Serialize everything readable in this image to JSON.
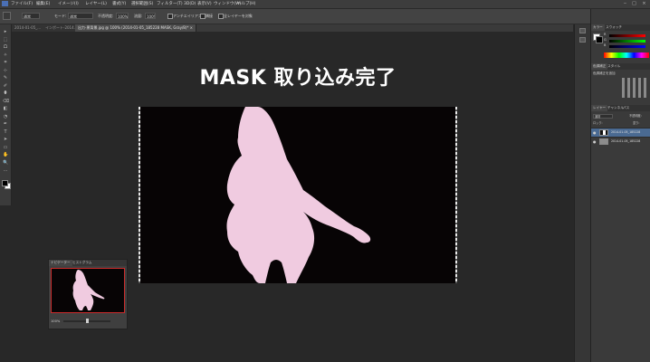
{
  "menu": {
    "items": [
      "ファイル(F)",
      "編集(E)",
      "イメージ(I)",
      "レイヤー(L)",
      "書式(Y)",
      "選択範囲(S)",
      "フィルター(T)",
      "3D(D)",
      "表示(V)",
      "ウィンドウ(W)",
      "ヘルプ(H)"
    ],
    "min_label": "‒",
    "max_label": "□",
    "close_label": "×"
  },
  "options": {
    "mode_value": "通常",
    "opacity_label": "モード:",
    "opacity_value": "100%",
    "flow_label": "不透明度:",
    "flow_value": "100%",
    "aa_label": "流量:",
    "aa_value": "100%",
    "tolerance_label": "許容値:",
    "tolerance_value": "32",
    "antialias_label": "アンチエイリアス",
    "contiguous_label": "隣接",
    "sample_all_label": "全レイヤーを対象"
  },
  "tabs": [
    "2014-01-05_...",
    "インポート-2014...",
    "出力-黒背景.jpg @ 100% (2014-01-05_185228 MASK, Gray/8)*  ×"
  ],
  "canvas": {
    "title": "MASK 取り込み完了",
    "bg_color": "#070405",
    "mask_color": "#f0cbe0"
  },
  "navigator": {
    "tab1": "ナビゲーター",
    "tab2": "ヒストグラム",
    "zoom": "100%"
  },
  "color_panel": {
    "tab1": "カラー",
    "tab2": "スウォッチ",
    "r_label": "R",
    "g_label": "G",
    "b_label": "B"
  },
  "adjust_panel": {
    "tab1": "色調補正",
    "tab2": "スタイル",
    "subtitle": "色調補正を追加"
  },
  "layers_panel": {
    "tab1": "レイヤー",
    "tab2": "チャンネル",
    "tab3": "パス",
    "blend": "通常",
    "opacity_label": "不透明度:",
    "lock_label": "ロック:",
    "fill_label": "塗り:",
    "layers": [
      {
        "name": "2014-01-05_185228",
        "thumb": "white-mask"
      },
      {
        "name": "2014-01-05_185228",
        "thumb": "photo"
      }
    ]
  }
}
